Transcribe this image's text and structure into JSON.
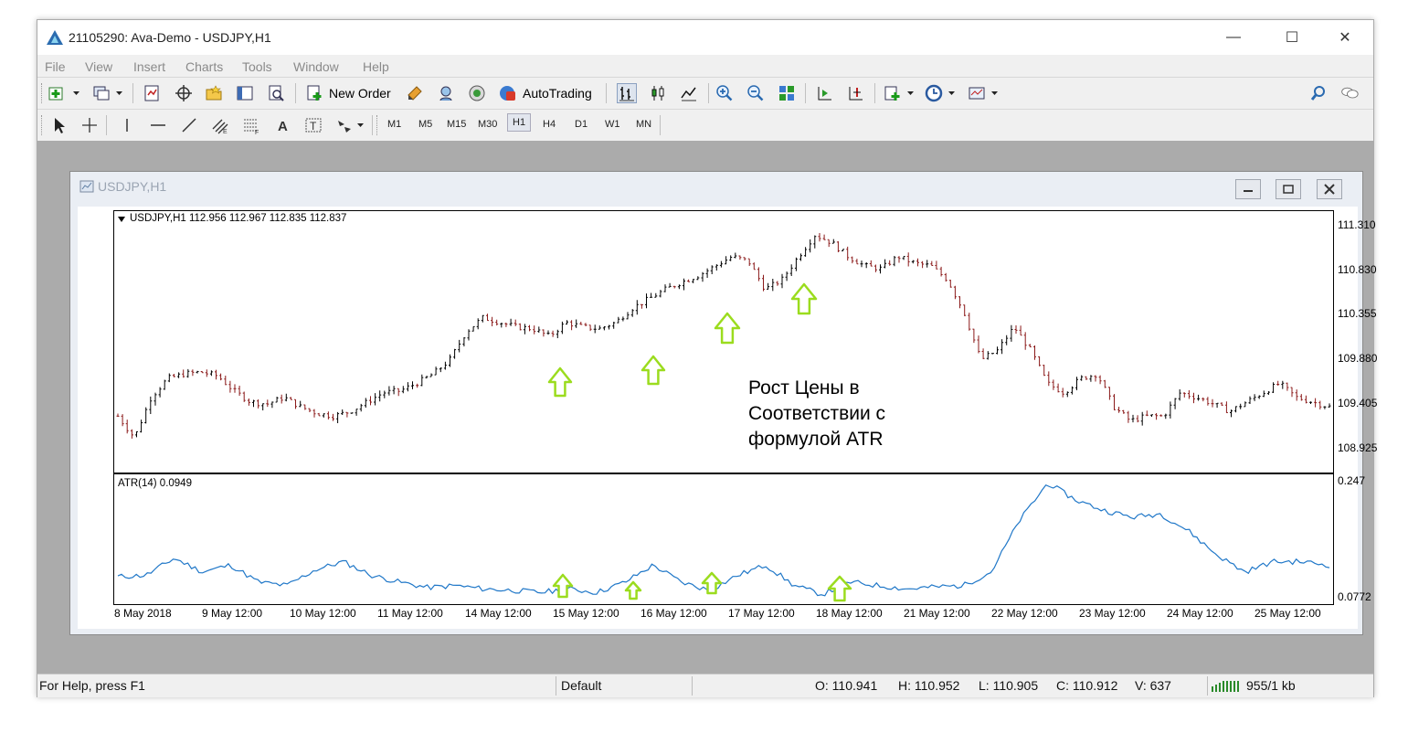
{
  "window": {
    "title": "21105290: Ava-Demo - USDJPY,H1"
  },
  "menu": [
    "File",
    "View",
    "Insert",
    "Charts",
    "Tools",
    "Window",
    "Help"
  ],
  "toolbar": {
    "new_order": "New Order",
    "autotrading": "AutoTrading"
  },
  "timeframes": [
    "M1",
    "M5",
    "M15",
    "M30",
    "H1",
    "H4",
    "D1",
    "W1",
    "MN"
  ],
  "active_timeframe": "H1",
  "chart_window": {
    "title": "USDJPY,H1",
    "header": "USDJPY,H1  112.956 112.967 112.835 112.837",
    "indicator_header": "ATR(14) 0.0949",
    "price_axis": [
      "111.310",
      "110.830",
      "110.355",
      "109.880",
      "109.405",
      "108.925"
    ],
    "atr_axis": [
      "0.247",
      "0.0772"
    ],
    "time_axis": [
      "8 May 2018",
      "9 May 12:00",
      "10 May 12:00",
      "11 May 12:00",
      "14 May 12:00",
      "15 May 12:00",
      "16 May 12:00",
      "17 May 12:00",
      "18 May 12:00",
      "21 May 12:00",
      "22 May 12:00",
      "23 May 12:00",
      "24 May 12:00",
      "25 May 12:00"
    ],
    "annotation": [
      "Рост Цены в",
      "Соответствии с",
      "формулой ATR"
    ]
  },
  "chart_data": {
    "type": "line",
    "series": [
      {
        "values": [
          109.35,
          109.12,
          109.55,
          109.75,
          109.8,
          109.82,
          109.78,
          109.62,
          109.5,
          109.48,
          109.55,
          109.45,
          109.38,
          109.35,
          109.4,
          109.5,
          109.6,
          109.62,
          109.7,
          109.8,
          109.95,
          110.25,
          110.4,
          110.35,
          110.3,
          110.28,
          110.2,
          110.35,
          110.3,
          110.28,
          110.35,
          110.5,
          110.6,
          110.7,
          110.78,
          110.85,
          110.95,
          111.05,
          111.0,
          110.7,
          110.8,
          111.05,
          111.28,
          111.2,
          111.05,
          110.95,
          110.92,
          111.05,
          110.98,
          110.95,
          110.8,
          110.45,
          109.95,
          110.05,
          110.3,
          110.05,
          109.7,
          109.6,
          109.75,
          109.8,
          109.45,
          109.3,
          109.35,
          109.35,
          109.6,
          109.55,
          109.48,
          109.4,
          109.5,
          109.6,
          109.7,
          109.55,
          109.5,
          109.45
        ]
      },
      {
        "values": [
          0.108,
          0.11,
          0.135,
          0.115,
          0.125,
          0.1,
          0.095,
          0.118,
          0.13,
          0.11,
          0.1,
          0.092,
          0.095,
          0.09,
          0.088,
          0.085,
          0.09,
          0.085,
          0.1,
          0.125,
          0.1,
          0.088,
          0.11,
          0.125,
          0.095,
          0.082,
          0.1,
          0.095,
          0.09,
          0.093,
          0.095,
          0.115,
          0.19,
          0.245,
          0.22,
          0.205,
          0.195,
          0.2,
          0.175,
          0.14,
          0.115,
          0.13,
          0.13,
          0.125
        ]
      }
    ]
  }
}
